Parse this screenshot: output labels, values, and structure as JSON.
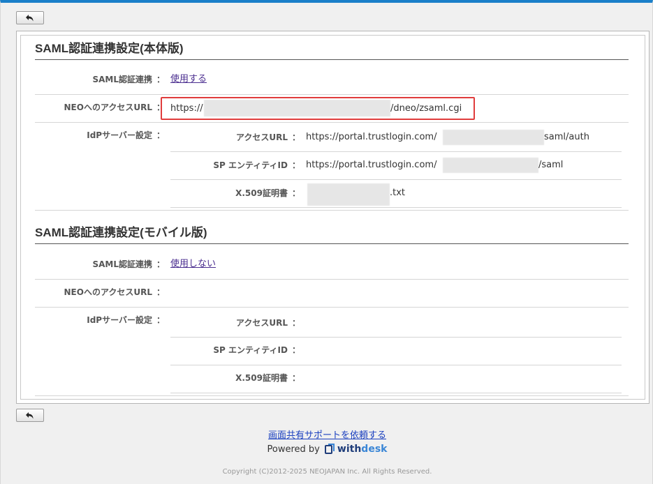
{
  "sections": [
    {
      "title": "SAML認証連携設定(本体版)",
      "saml_label": "SAML認証連携",
      "saml_value": "使用する",
      "neo_url_label": "NEOへのアクセスURL",
      "neo_url_prefix": "https://",
      "neo_url_suffix": "/dneo/zsaml.cgi",
      "idp_label": "IdPサーバー設定",
      "access_url_label": "アクセスURL",
      "access_url_prefix": "https://portal.trustlogin.com/",
      "access_url_suffix": "saml/auth",
      "sp_entity_label": "SP エンティティID",
      "sp_entity_prefix": "https://portal.trustlogin.com/",
      "sp_entity_suffix": "/saml",
      "cert_label": "X.509証明書",
      "cert_suffix": ".txt"
    },
    {
      "title": "SAML認証連携設定(モバイル版)",
      "saml_label": "SAML認証連携",
      "saml_value": "使用しない",
      "neo_url_label": "NEOへのアクセスURL",
      "idp_label": "IdPサーバー設定",
      "access_url_label": "アクセスURL",
      "sp_entity_label": "SP エンティティID",
      "cert_label": "X.509証明書"
    }
  ],
  "colon": "：",
  "footer": {
    "support_link": "画面共有サポートを依頼する",
    "powered_by": "Powered by",
    "brand_part1": "with",
    "brand_part2": "desk",
    "copyright": "Copyright (C)2012-2025 NEOJAPAN Inc. All Rights Reserved."
  },
  "icons": {
    "back": "back-arrow-icon",
    "brand": "withdesk-logo-icon"
  },
  "colors": {
    "accent": "#1a7fc9",
    "highlight": "#e03c3c",
    "link": "#4a2d8f"
  }
}
